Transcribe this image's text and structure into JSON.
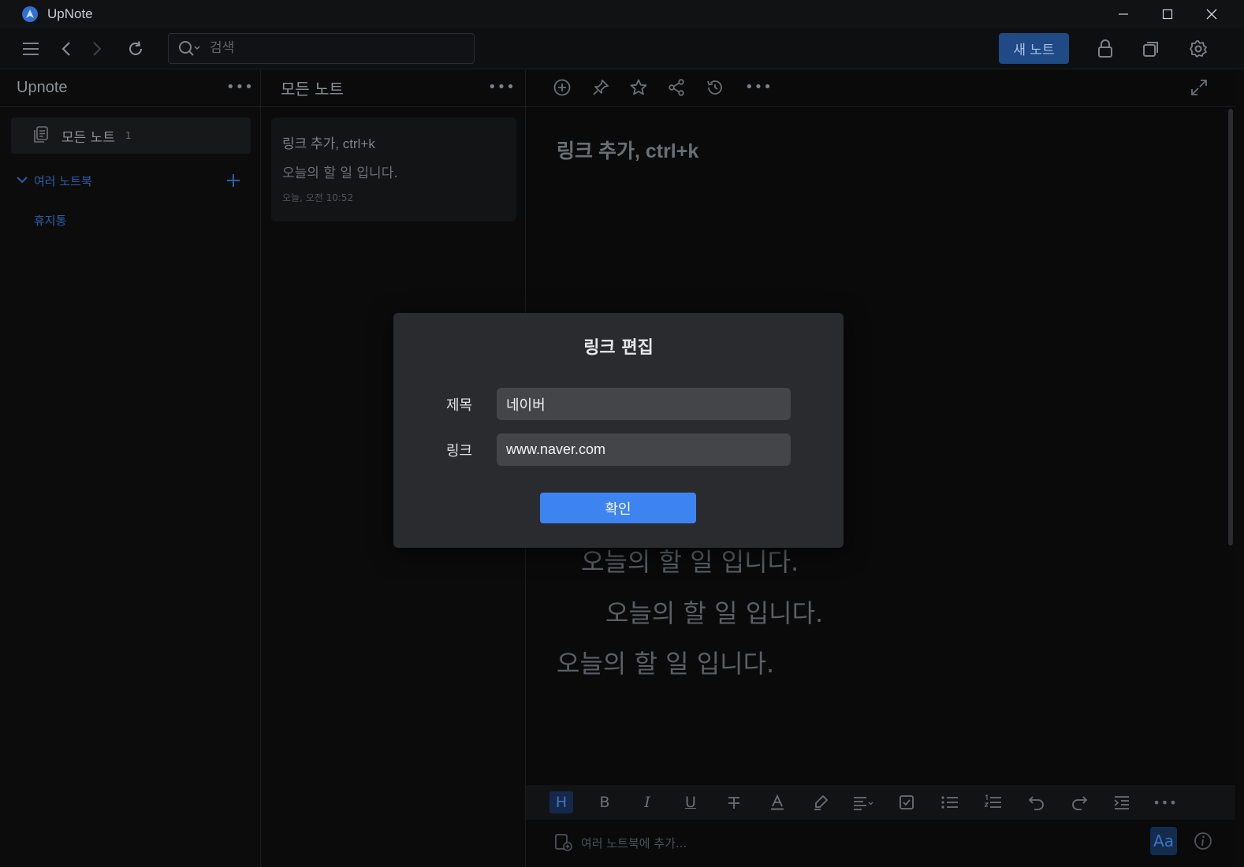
{
  "window": {
    "app_title": "UpNote"
  },
  "toolbar": {
    "search_placeholder": "검색",
    "new_note_label": "새 노트"
  },
  "sidebar": {
    "title": "Upnote",
    "all_notes_label": "모든 노트",
    "all_notes_count": "1",
    "notebooks_label": "여러 노트북",
    "trash_label": "휴지통"
  },
  "note_list": {
    "title": "모든 노트",
    "notes": [
      {
        "title": "링크 추가, ctrl+k",
        "snippet": "오늘의 할 일 입니다.",
        "time": "오늘, 오전 10:52"
      }
    ]
  },
  "editor": {
    "title": "링크 추가, ctrl+k",
    "lines": [
      "오늘의 할 일 입니다.",
      "오늘의 할 일 입니다.",
      "오늘의 할 일 입니다."
    ],
    "add_notebook_placeholder": "여러 노트북에 추가...",
    "format_heading": "H",
    "format_bold": "B",
    "format_italic": "I",
    "format_underline": "U",
    "format_aa": "Aa"
  },
  "dialog": {
    "title": "링크 편집",
    "title_label": "제목",
    "title_value": "네이버",
    "link_label": "링크",
    "link_value": "www.naver.com",
    "confirm_label": "확인"
  },
  "colors": {
    "accent": "#3d84f0",
    "new_note_bg": "#1f4a86",
    "sidebar_link": "#2b5fa8"
  }
}
